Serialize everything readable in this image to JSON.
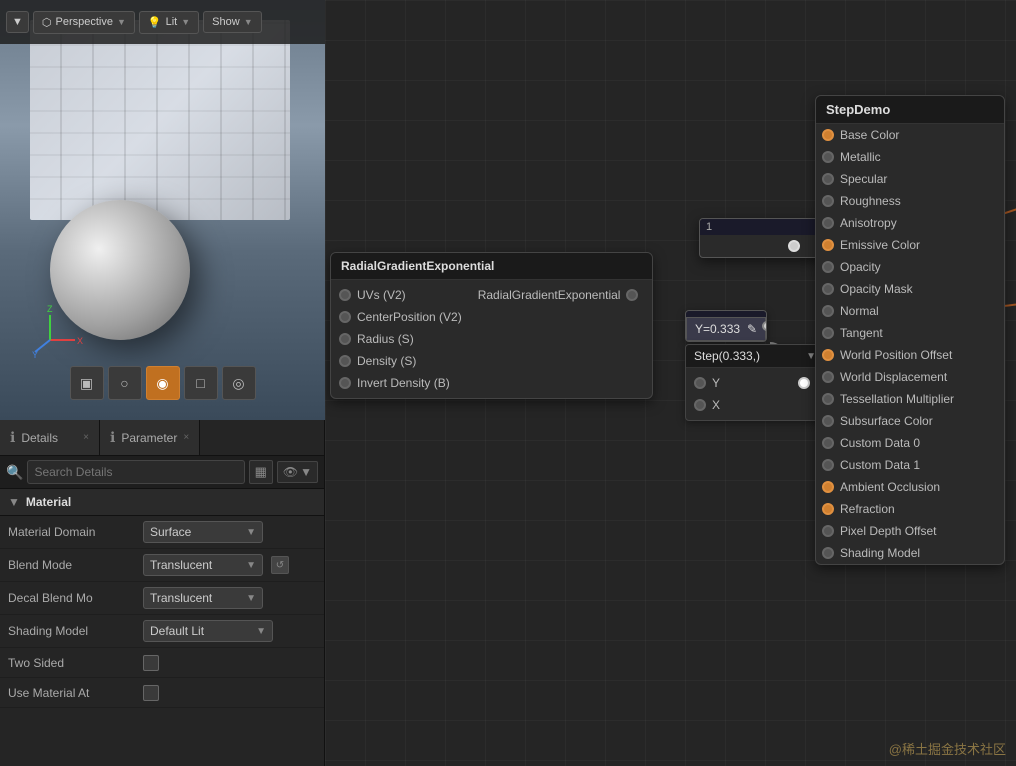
{
  "viewport": {
    "toolbar": {
      "dropdown_arrow": "▼",
      "perspective_label": "Perspective",
      "lit_label": "Lit",
      "show_label": "Show"
    },
    "shapes": [
      "▣",
      "○",
      "◆",
      "□",
      "◎"
    ]
  },
  "tabs": [
    {
      "id": "details",
      "icon": "ℹ",
      "label": "Details",
      "close": "×"
    },
    {
      "id": "parameters",
      "icon": "ℹ",
      "label": "Parameter",
      "close": "×"
    }
  ],
  "search": {
    "placeholder": "Search Details",
    "icon": "🔍"
  },
  "material_section": {
    "title": "Material",
    "properties": [
      {
        "label": "Material Domain",
        "value": "Surface",
        "type": "dropdown"
      },
      {
        "label": "Blend Mode",
        "value": "Translucent",
        "type": "dropdown",
        "reset": true
      },
      {
        "label": "Decal Blend Mo",
        "value": "Translucent",
        "type": "dropdown"
      },
      {
        "label": "Shading Model",
        "value": "Default Lit",
        "type": "dropdown"
      },
      {
        "label": "Two Sided",
        "value": "",
        "type": "checkbox"
      },
      {
        "label": "Use Material At",
        "value": "",
        "type": "checkbox"
      }
    ]
  },
  "nodes": {
    "stepdemo": {
      "title": "StepDemo",
      "pins": [
        {
          "label": "Base Color",
          "color": "orange"
        },
        {
          "label": "Metallic",
          "color": "gray"
        },
        {
          "label": "Specular",
          "color": "gray"
        },
        {
          "label": "Roughness",
          "color": "gray"
        },
        {
          "label": "Anisotropy",
          "color": "gray"
        },
        {
          "label": "Emissive Color",
          "color": "orange-filled"
        },
        {
          "label": "Opacity",
          "color": "gray"
        },
        {
          "label": "Opacity Mask",
          "color": "gray"
        },
        {
          "label": "Normal",
          "color": "gray"
        },
        {
          "label": "Tangent",
          "color": "gray"
        },
        {
          "label": "World Position Offset",
          "color": "orange-filled"
        },
        {
          "label": "World Displacement",
          "color": "gray"
        },
        {
          "label": "Tessellation Multiplier",
          "color": "gray"
        },
        {
          "label": "Subsurface Color",
          "color": "gray"
        },
        {
          "label": "Custom Data 0",
          "color": "gray"
        },
        {
          "label": "Custom Data 1",
          "color": "gray"
        },
        {
          "label": "Ambient Occlusion",
          "color": "orange-filled"
        },
        {
          "label": "Refraction",
          "color": "orange-filled"
        },
        {
          "label": "Pixel Depth Offset",
          "color": "gray"
        },
        {
          "label": "Shading Model",
          "color": "gray"
        }
      ]
    },
    "radial": {
      "title": "RadialGradientExponential",
      "inputs": [
        "UVs (V2)",
        "CenterPosition (V2)",
        "Radius (S)",
        "Density (S)",
        "Invert Density (B)"
      ],
      "output": "RadialGradientExponential"
    },
    "constant": {
      "value": "Y=0.333",
      "edit_icon": "✎"
    },
    "step": {
      "title": "Step(0.333,)",
      "pins_out": [
        "Y",
        "X"
      ]
    },
    "small_const": {
      "value": "1",
      "dropdown": "▼"
    }
  },
  "watermark": "@稀土掘金技术社区"
}
